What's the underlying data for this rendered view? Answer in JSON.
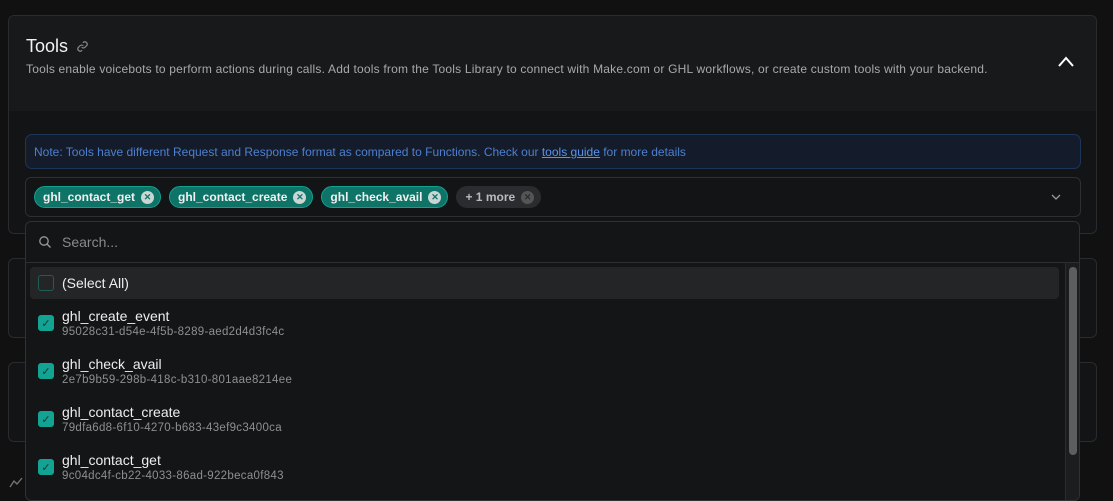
{
  "section": {
    "title": "Tools",
    "description": "Tools enable voicebots to perform actions during calls. Add tools from the Tools Library to connect with Make.com or GHL workflows, or create custom tools with your backend."
  },
  "note": {
    "prefix": "Note: Tools have different Request and Response format as compared to Functions. Check our ",
    "link": "tools guide",
    "suffix": " for more details"
  },
  "selected": [
    {
      "label": "ghl_contact_get"
    },
    {
      "label": "ghl_contact_create"
    },
    {
      "label": "ghl_check_avail"
    }
  ],
  "more_label": "+ 1 more",
  "search": {
    "placeholder": "Search...",
    "value": ""
  },
  "select_all": "(Select All)",
  "options": [
    {
      "name": "ghl_create_event",
      "id": "95028c31-d54e-4f5b-8289-aed2d4d3fc4c",
      "checked": true
    },
    {
      "name": "ghl_check_avail",
      "id": "2e7b9b59-298b-418c-b310-801aae8214ee",
      "checked": true
    },
    {
      "name": "ghl_contact_create",
      "id": "79dfa6d8-6f10-4270-b683-43ef9c3400ca",
      "checked": true
    },
    {
      "name": "ghl_contact_get",
      "id": "9c04dc4f-cb22-4033-86ad-922beca0f843",
      "checked": true
    }
  ],
  "colors": {
    "accent": "#12a392",
    "chip": "#0e7468",
    "link": "#5b93ee"
  }
}
